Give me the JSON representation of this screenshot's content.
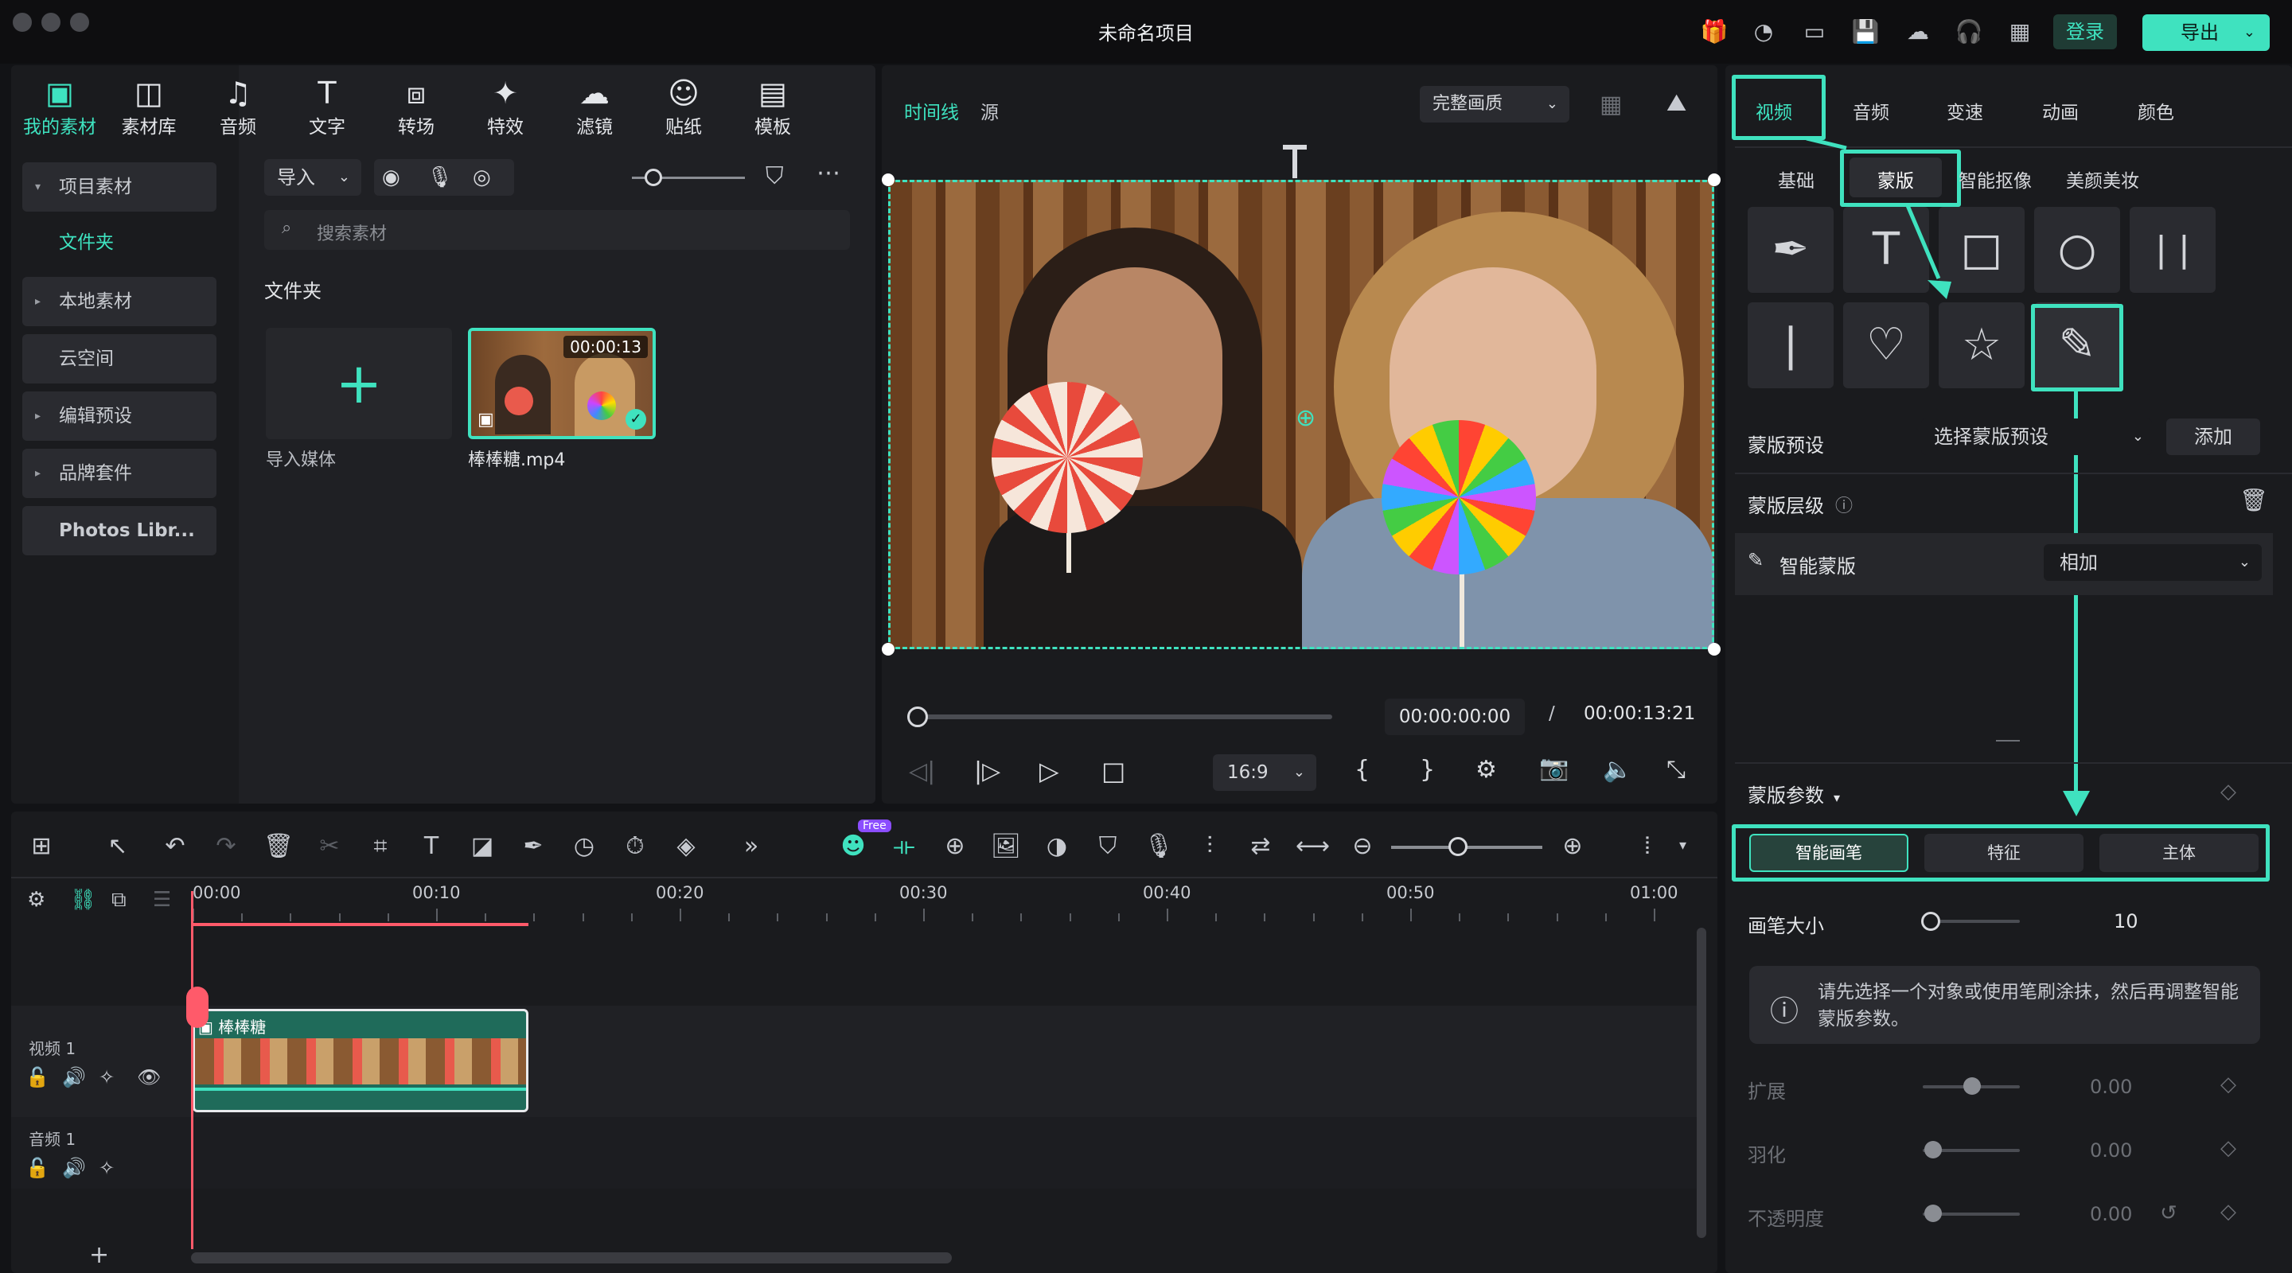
{
  "window": {
    "title": "未命名项目"
  },
  "header": {
    "login": "登录",
    "export": "导出"
  },
  "media_nav": [
    {
      "label": "我的素材",
      "icon": "my-media-icon",
      "active": true
    },
    {
      "label": "素材库",
      "icon": "stock-media-icon"
    },
    {
      "label": "音频",
      "icon": "music-note-icon"
    },
    {
      "label": "文字",
      "icon": "text-t-icon"
    },
    {
      "label": "转场",
      "icon": "transition-icon"
    },
    {
      "label": "特效",
      "icon": "effects-icon"
    },
    {
      "label": "滤镜",
      "icon": "filter-icon"
    },
    {
      "label": "贴纸",
      "icon": "sticker-icon"
    },
    {
      "label": "模板",
      "icon": "template-icon"
    }
  ],
  "sidebar": {
    "items": [
      {
        "label": "项目素材",
        "arrow": "▾"
      },
      {
        "label": "文件夹",
        "selected": true
      },
      {
        "label": "本地素材",
        "arrow": "▸"
      },
      {
        "label": "云空间"
      },
      {
        "label": "编辑预设",
        "arrow": "▸"
      },
      {
        "label": "品牌套件",
        "arrow": "▸"
      },
      {
        "label": "Photos Libr..."
      }
    ]
  },
  "media": {
    "import_label": "导入",
    "search_placeholder": "搜索素材",
    "folder_title": "文件夹",
    "import_media_label": "导入媒体",
    "clip_name": "棒棒糖.mp4",
    "clip_duration": "00:00:13"
  },
  "preview": {
    "tab_timeline": "时间线",
    "tab_source": "源",
    "quality": "完整画质",
    "current_time": "00:00:00:00",
    "separator": "/",
    "total_time": "00:00:13:21",
    "aspect": "16:9",
    "bracket_in": "{",
    "bracket_out": "}"
  },
  "right_panel": {
    "tabs": [
      "视频",
      "音频",
      "变速",
      "动画",
      "颜色"
    ],
    "subtabs": [
      "基础",
      "蒙版",
      "智能抠像",
      "美颜美妆"
    ],
    "mask_preset_label": "蒙版预设",
    "mask_preset_value": "选择蒙版预设",
    "add_label": "添加",
    "mask_layer_label": "蒙版层级",
    "smart_mask_label": "智能蒙版",
    "blend_value": "相加",
    "mask_params_label": "蒙版参数",
    "mode_tabs": [
      "智能画笔",
      "特征",
      "主体"
    ],
    "brush_size_label": "画笔大小",
    "brush_size_value": "10",
    "brush_size_fraction": 0.05,
    "info_text": "请先选择一个对象或使用笔刷涂抹，然后再调整智能蒙版参数。",
    "params": [
      {
        "label": "扩展",
        "value": "0.00",
        "fraction": 0.5
      },
      {
        "label": "羽化",
        "value": "0.00",
        "fraction": 0.1
      },
      {
        "label": "不透明度",
        "value": "0.00",
        "fraction": 0.1
      }
    ]
  },
  "timeline": {
    "ruler": [
      "00:00",
      "00:10",
      "00:20",
      "00:30",
      "00:40",
      "00:50",
      "01:00"
    ],
    "free_badge": "Free",
    "track_video": "视频 1",
    "track_audio": "音频 1",
    "clip_label": "棒棒糖"
  },
  "colors": {
    "accent": "#3fe2bf",
    "playhead": "#ff5a6a",
    "panel": "#1f2024"
  }
}
